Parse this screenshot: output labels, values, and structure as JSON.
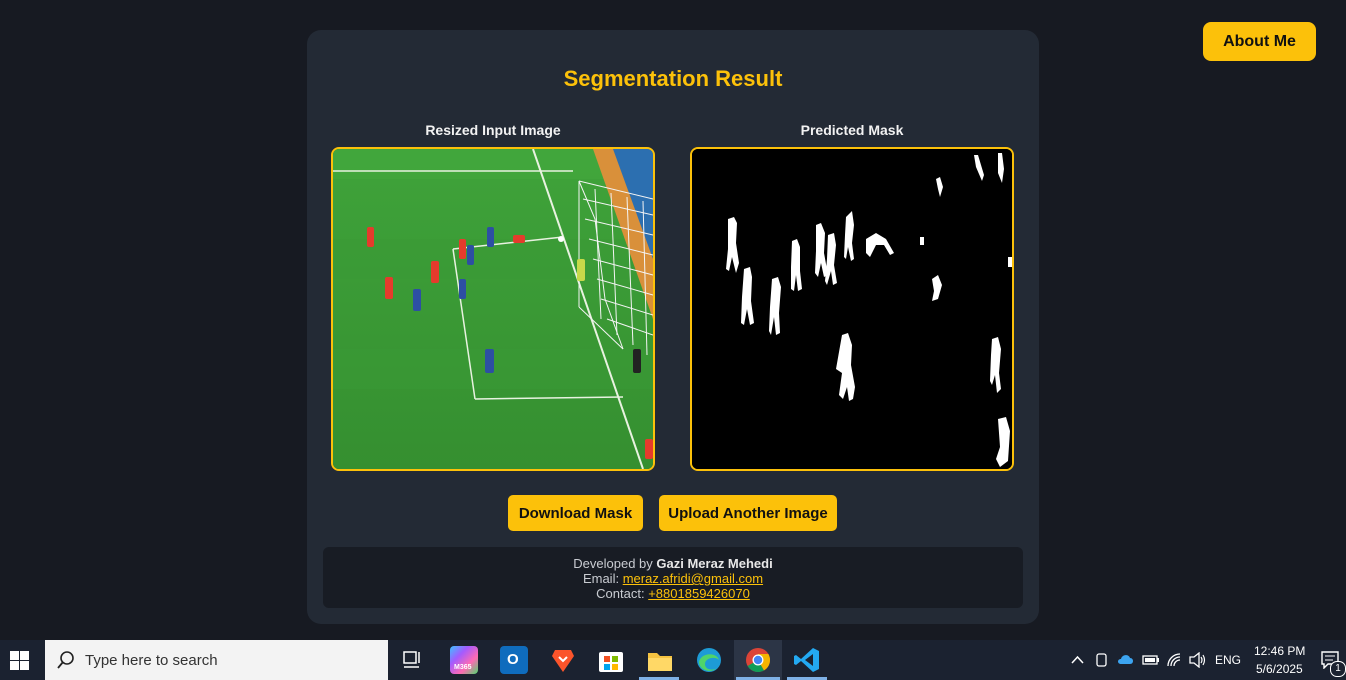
{
  "nav": {
    "about_label": "About Me"
  },
  "card": {
    "title": "Segmentation Result",
    "input_label": "Resized Input Image",
    "mask_label": "Predicted Mask",
    "download_label": "Download Mask",
    "upload_label": "Upload Another Image"
  },
  "footer": {
    "developed_prefix": "Developed by",
    "developer_name": "Gazi Meraz Mehedi",
    "email_prefix": "Email:",
    "email": "meraz.afridi@gmail.com",
    "contact_prefix": "Contact:",
    "phone": "+8801859426070"
  },
  "taskbar": {
    "search_placeholder": "Type here to search",
    "apps": [
      "task-view",
      "microsoft-365",
      "outlook",
      "brave",
      "microsoft-store",
      "file-explorer",
      "edge",
      "chrome",
      "vscode"
    ],
    "m365_label": "M365",
    "language": "ENG",
    "time": "12:46 PM",
    "date": "5/6/2025",
    "notification_count": "1"
  },
  "colors": {
    "accent": "#fcc10a",
    "background": "#171a22",
    "card": "#232a35"
  }
}
